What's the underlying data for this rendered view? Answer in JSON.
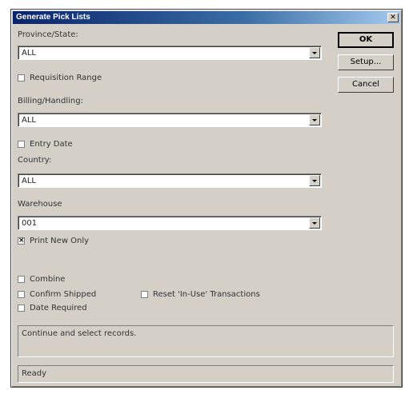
{
  "window": {
    "title": "Generate Pick Lists"
  },
  "fields": {
    "province_label": "Province/State:",
    "province_value": "ALL",
    "requisition_label": "Requisition Range",
    "billing_label": "Billing/Handling:",
    "billing_value": "ALL",
    "entry_date_label": "Entry Date",
    "country_label": "Country:",
    "country_value": "ALL",
    "warehouse_label": "Warehouse",
    "warehouse_value": "001",
    "print_new_label": "Print New Only",
    "combine_label": "Combine",
    "confirm_shipped_label": "Confirm Shipped",
    "reset_label": "Reset 'In-Use' Transactions",
    "date_required_label": "Date Required"
  },
  "checks": {
    "requisition": false,
    "entry_date": false,
    "print_new": true,
    "combine": false,
    "confirm_shipped": false,
    "reset": false,
    "date_required": false
  },
  "buttons": {
    "ok": "OK",
    "setup": "Setup...",
    "cancel": "Cancel"
  },
  "status": {
    "message": "Continue and select records.",
    "state": "Ready"
  }
}
